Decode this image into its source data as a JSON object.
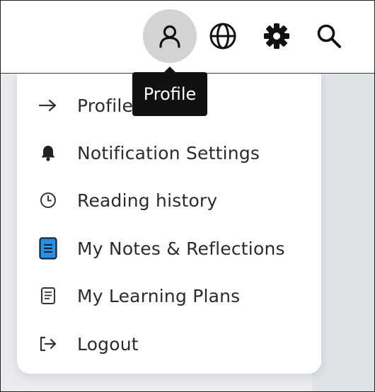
{
  "topbar": {
    "buttons": [
      {
        "id": "profile",
        "icon": "user-icon"
      },
      {
        "id": "language",
        "icon": "globe-icon"
      },
      {
        "id": "settings",
        "icon": "gear-icon"
      },
      {
        "id": "search",
        "icon": "search-icon"
      }
    ],
    "active_button": "profile"
  },
  "tooltip": {
    "text": "Profile"
  },
  "menu": {
    "items": [
      {
        "label": "Profile",
        "icon": "arrow-right-icon"
      },
      {
        "label": "Notification Settings",
        "icon": "bell-icon"
      },
      {
        "label": "Reading history",
        "icon": "clock-icon"
      },
      {
        "label": "My Notes & Reflections",
        "icon": "notes-icon"
      },
      {
        "label": "My Learning Plans",
        "icon": "document-icon"
      },
      {
        "label": "Logout",
        "icon": "logout-icon"
      }
    ]
  },
  "colors": {
    "active_circle": "#d3d3d3",
    "tooltip_bg": "#111111",
    "notes_icon_fill": "#2d8fe0",
    "backdrop": "#e9ebee"
  }
}
